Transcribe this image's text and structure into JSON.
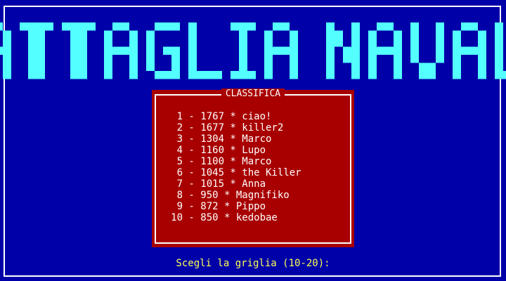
{
  "title": "BATTAGLIA NAVALE",
  "colors": {
    "background": "#0000a8",
    "title": "#54ffff",
    "panel": "#a80000",
    "border": "#ffffff",
    "prompt": "#ffff54"
  },
  "scoreboard": {
    "caption": "CLASSIFICA",
    "separator_dash": "-",
    "separator_star": "*",
    "rows": [
      {
        "rank": "1",
        "score": "1767",
        "name": "ciao!"
      },
      {
        "rank": "2",
        "score": "1677",
        "name": "killer2"
      },
      {
        "rank": "3",
        "score": "1304",
        "name": "Marco"
      },
      {
        "rank": "4",
        "score": "1160",
        "name": "Lupo"
      },
      {
        "rank": "5",
        "score": "1100",
        "name": "Marco"
      },
      {
        "rank": "6",
        "score": "1045",
        "name": "the Killer"
      },
      {
        "rank": "7",
        "score": "1015",
        "name": "Anna"
      },
      {
        "rank": "8",
        "score": "950",
        "name": "Magnifiko"
      },
      {
        "rank": "9",
        "score": "872",
        "name": "Pippo"
      },
      {
        "rank": "10",
        "score": "850",
        "name": "kedobae"
      }
    ]
  },
  "prompt": "Scegli la griglia (10-20):"
}
